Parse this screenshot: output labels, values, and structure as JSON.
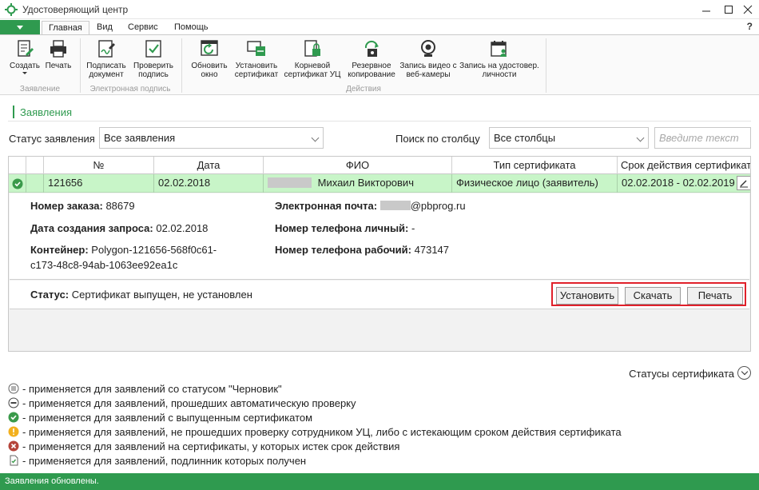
{
  "window": {
    "title": "Удостоверяющий центр",
    "help": "?"
  },
  "tabs": [
    {
      "label": "Главная"
    },
    {
      "label": "Вид"
    },
    {
      "label": "Сервис"
    },
    {
      "label": "Помощь"
    }
  ],
  "ribbon": {
    "create": "Создать",
    "print": "Печать",
    "sign_doc": "Подписать документ",
    "check_sign": "Проверить подпись",
    "refresh": "Обновить окно",
    "install_cert": "Установить сертификат",
    "root_cert": "Корневой сертификат УЦ",
    "backup": "Резервное копирование",
    "webcam": "Запись видео с веб-камеры",
    "id_record": "Запись на удостовер. личности",
    "groups": {
      "application": "Заявление",
      "esign": "Электронная подпись",
      "actions": "Действия"
    }
  },
  "section": {
    "title": "Заявления"
  },
  "filters": {
    "status_label": "Статус заявления",
    "status_value": "Все заявления",
    "search_label": "Поиск по столбцу",
    "column_value": "Все столбцы",
    "search_placeholder": "Введите текст"
  },
  "table": {
    "columns": [
      "№",
      "Дата",
      "ФИО",
      "Тип сертификата",
      "Срок действия сертификата"
    ],
    "row": {
      "number": "121656",
      "date": "02.02.2018",
      "fio": "Михаил Викторович",
      "cert_type": "Физическое лицо (заявитель)",
      "validity": "02.02.2018  -  02.02.2019"
    }
  },
  "details": {
    "order_label": "Номер заказа:",
    "order_value": "88679",
    "request_date_label": "Дата создания запроса:",
    "request_date_value": "02.02.2018",
    "container_label": "Контейнер:",
    "container_value_1": "Polygon-121656-568f0c61-",
    "container_value_2": "c173-48c8-94ab-1063ee92ea1c",
    "email_label": "Электронная почта:",
    "email_value": "@pbprog.ru",
    "phone_personal_label": "Номер телефона личный:",
    "phone_personal_value": "-",
    "phone_work_label": "Номер телефона рабочий:",
    "phone_work_value": "473147",
    "status_label": "Статус:",
    "status_value": "Сертификат выпущен, не установлен",
    "btn_install": "Установить",
    "btn_download": "Скачать",
    "btn_print": "Печать"
  },
  "legend": {
    "title": "Статусы сертификата",
    "items": [
      {
        "icon": "draft-icon",
        "text": "- применяется для заявлений со статусом \"Черновик\""
      },
      {
        "icon": "auto-check-icon",
        "text": "- применяется для заявлений, прошедших автоматическую проверку"
      },
      {
        "icon": "issued-icon",
        "text": "- применяется для заявлений с выпущенным сертификатом"
      },
      {
        "icon": "warning-icon",
        "text": "- применяется для заявлений, не прошедших проверку сотрудником УЦ, либо с истекающим сроком действия сертификата"
      },
      {
        "icon": "expired-icon",
        "text": "- применяется для заявлений на сертификаты, у которых истек срок действия"
      },
      {
        "icon": "original-received-icon",
        "text": "- применяется для заявлений, подлинник которых получен"
      }
    ]
  },
  "statusbar": {
    "text": "Заявления обновлены."
  },
  "colors": {
    "accent": "#2f9a4f",
    "row_selected": "#c8f5c8",
    "highlight": "#e0202a"
  }
}
